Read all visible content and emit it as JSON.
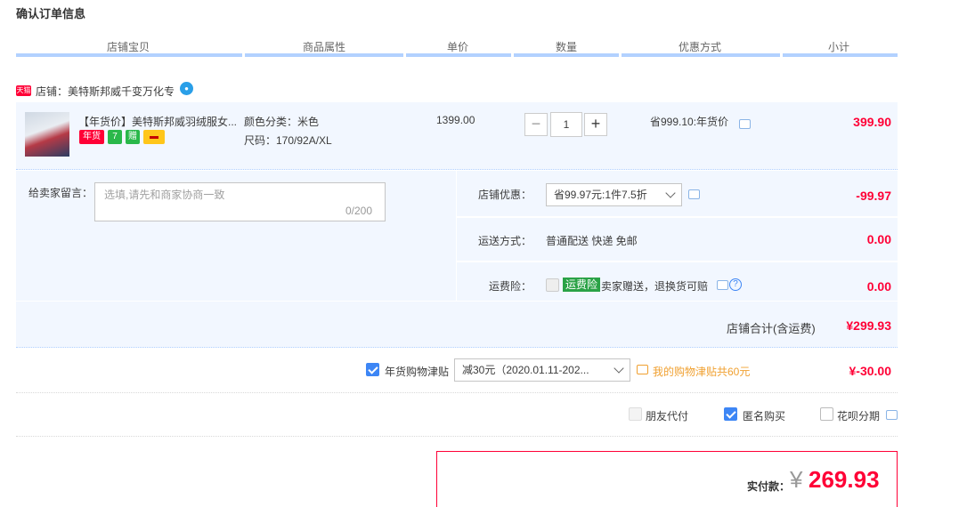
{
  "page_title": "确认订单信息",
  "table_headers": [
    "店铺宝贝",
    "商品属性",
    "单价",
    "数量",
    "优惠方式",
    "小计"
  ],
  "shop": {
    "tag": "天猫",
    "name": "店铺：美特斯邦威千变万化专"
  },
  "item": {
    "title": "【年货价】美特斯邦威羽绒服女...",
    "badges": [
      "年货",
      "7",
      "赠",
      "▬"
    ],
    "color": "颜色分类：米色",
    "size": "尺码：170/92A/XL",
    "unit_price": "1399.00",
    "quantity": "1",
    "qty_minus": "−",
    "qty_plus": "+",
    "discount": "省999.10:年货价",
    "subtotal": "399.90"
  },
  "message": {
    "label": "给卖家留言：",
    "placeholder": "选填,请先和商家协商一致",
    "count": "0/200"
  },
  "shop_discount": {
    "label": "店铺优惠：",
    "value": "省99.97元:1件7.5折",
    "amount": "-99.97"
  },
  "shipping": {
    "label": "运送方式：",
    "value": "普通配送 快递 免邮",
    "amount": "0.00"
  },
  "insurance": {
    "label": "运费险：",
    "tag": "运费险",
    "text": "卖家赠送，退换货可赔",
    "amount": "0.00"
  },
  "shop_total": {
    "label": "店铺合计(含运费)",
    "amount": "¥299.93"
  },
  "allowance": {
    "label": "年货购物津贴",
    "value": "减30元（2020.01.11-202...",
    "note": "我的购物津贴共60元",
    "amount": "¥-30.00"
  },
  "options": {
    "friend_pay": "朋友代付",
    "anonymous": "匿名购买",
    "huabei": "花呗分期"
  },
  "final": {
    "label": "实付款：",
    "currency": "¥",
    "amount": "269.93"
  },
  "colors": {
    "accent_red": "#ff0036",
    "panel_blue": "#f2f7ff",
    "check_blue": "#3d86f5"
  }
}
